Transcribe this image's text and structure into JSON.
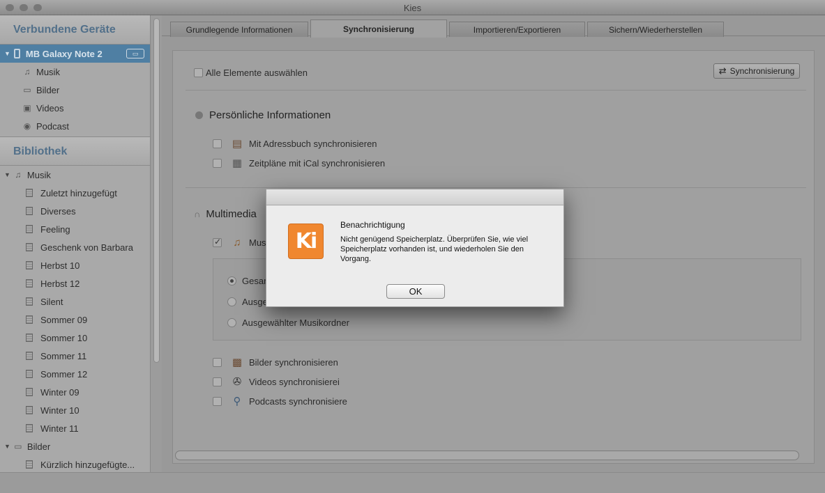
{
  "window": {
    "title": "Kies"
  },
  "sidebar": {
    "connected_header": "Verbundene Geräte",
    "device": {
      "name": "MB Galaxy Note 2"
    },
    "device_items": [
      {
        "label": "Musik",
        "icon": "music-note-icon"
      },
      {
        "label": "Bilder",
        "icon": "picture-icon"
      },
      {
        "label": "Videos",
        "icon": "film-icon"
      },
      {
        "label": "Podcast",
        "icon": "podcast-icon"
      }
    ],
    "library_header": "Bibliothek",
    "library": {
      "music_label": "Musik",
      "playlists": [
        "Zuletzt hinzugefügt",
        "Diverses",
        "Feeling",
        "Geschenk von Barbara",
        "Herbst 10",
        "Herbst 12",
        "Silent",
        "Sommer 09",
        "Sommer 10",
        "Sommer 11",
        "Sommer 12",
        "Winter 09",
        "Winter 10",
        "Winter 11"
      ],
      "pictures_label": "Bilder",
      "pictures_items": [
        "Kürzlich hinzugefügte..."
      ]
    }
  },
  "tabs": [
    "Grundlegende Informationen",
    "Synchronisierung",
    "Importieren/Exportieren",
    "Sichern/Wiederherstellen"
  ],
  "active_tab": "Synchronisierung",
  "sync": {
    "select_all_label": "Alle Elemente auswählen",
    "sync_button_label": "Synchronisierung",
    "personal": {
      "title": "Persönliche Informationen",
      "addressbook_label": "Mit Adressbuch synchronisieren",
      "ical_label": "Zeitpläne mit iCal synchronisieren"
    },
    "multimedia": {
      "title": "Multimedia",
      "music_label": "Mus",
      "music_checked": true,
      "radio_all": "Gesam",
      "radio_selected": "Ausge",
      "radio_folder": "Ausgewählter Musikordner",
      "pictures_label": "Bilder synchronisieren",
      "videos_label": "Videos synchronisierei",
      "podcasts_label": "Podcasts synchronisiere"
    }
  },
  "dialog": {
    "logo_text": "Ki",
    "title": "Benachrichtigung",
    "message": "Nicht genügend Speicherplatz. Überprüfen Sie, wie viel Speicherplatz vorhanden ist, und wiederholen Sie den Vorgang.",
    "ok_label": "OK"
  },
  "colors": {
    "accent": "#4f7fa3",
    "kies_orange": "#f0872f"
  }
}
